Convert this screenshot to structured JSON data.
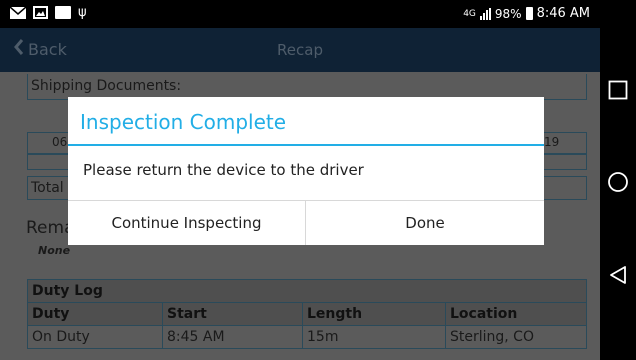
{
  "status_bar": {
    "network": "4G",
    "battery": "98%",
    "time": "8:46 AM"
  },
  "nav": {
    "back_label": "Back",
    "title": "Recap"
  },
  "background": {
    "shipping_label": "Shipping Documents:",
    "date_left": "06",
    "date_right": "19",
    "total_label": "Total",
    "remarks_label": "Rema",
    "remarks_value": "None"
  },
  "duty_log": {
    "title": "Duty Log",
    "columns": [
      "Duty",
      "Start",
      "Length",
      "Location"
    ],
    "rows": [
      [
        "On Duty",
        "8:45 AM",
        "15m",
        "Sterling, CO"
      ]
    ]
  },
  "dialog": {
    "title": "Inspection Complete",
    "message": "Please return the device to the driver",
    "continue_label": "Continue Inspecting",
    "done_label": "Done",
    "accent": "#22aee6"
  }
}
